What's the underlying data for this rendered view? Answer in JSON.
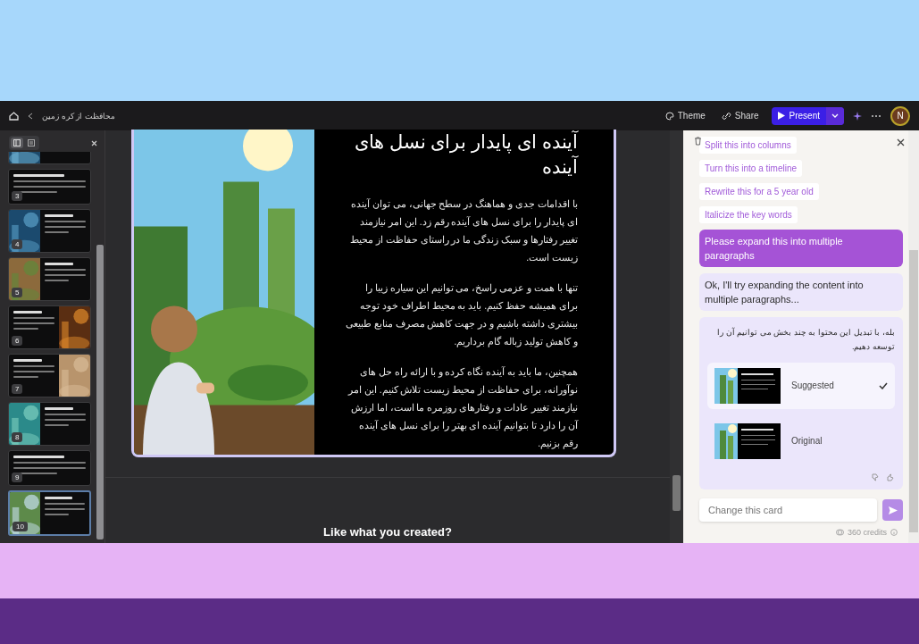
{
  "toolbar": {
    "breadcrumb": "محافظت از کره زمین",
    "theme_button": {
      "label": "Theme"
    },
    "share_button": {
      "label": "Share"
    },
    "present": {
      "label": "Present"
    },
    "avatar": "N"
  },
  "sidebar": {
    "view_tabs": [
      {
        "kind": "cards",
        "selected": true
      },
      {
        "kind": "outline",
        "selected": false
      }
    ],
    "slides": [
      {
        "kind": "image-left",
        "selected": false
      },
      {
        "number": "3",
        "kind": "text",
        "selected": false
      },
      {
        "number": "4",
        "kind": "image-left",
        "selected": false
      },
      {
        "number": "5",
        "kind": "image-left",
        "selected": false
      },
      {
        "number": "6",
        "kind": "image-right",
        "selected": false
      },
      {
        "number": "7",
        "kind": "image-right",
        "selected": false
      },
      {
        "number": "8",
        "kind": "image-left",
        "selected": false
      },
      {
        "number": "9",
        "kind": "text",
        "selected": false
      },
      {
        "number": "10",
        "kind": "image-left",
        "selected": true
      }
    ]
  },
  "slide": {
    "title": "آینده ای پایدار برای نسل های آینده",
    "paragraphs": [
      "با اقدامات جدی و هماهنگ در سطح جهانی، می توان آینده ای پایدار را برای نسل های آینده رقم زد. این امر نیازمند تغییر رفتارها و سبک زندگی ما در راستای حفاظت از محیط زیست است.",
      "تنها با همت و عزمی راسخ، می توانیم این سیاره زیبا را برای همیشه حفظ کنیم. باید به محیط اطراف خود توجه بیشتری داشته باشیم و در جهت کاهش مصرف منابع طبیعی و کاهش تولید زباله گام برداریم.",
      "همچنین، ما باید به آینده نگاه کرده و با ارائه راه حل های نوآورانه، برای حفاظت از محیط زیست تلاش کنیم. این امر نیازمند تغییر عادات و رفتارهای روزمره ما است، اما ارزش آن را دارد تا بتوانیم آینده ای بهتر را برای نسل های آینده رقم بزنیم."
    ]
  },
  "feedback_prompt": "Like what you created?",
  "assistant": {
    "suggestions": [
      "Split this into columns",
      "Turn this into a timeline",
      "Rewrite this for a 5 year old",
      "Italicize the key words"
    ],
    "messages": [
      {
        "kind": "user",
        "text": "Please expand this into multiple paragraphs"
      },
      {
        "kind": "assistant",
        "text": "Ok, I'll try expanding the content into multiple paragraphs..."
      },
      {
        "kind": "assistant",
        "text": "بله، با تبدیل این محتوا به چند بخش می توانیم آن را توسعه دهیم.",
        "options": [
          {
            "label": "Suggested",
            "selected": true
          },
          {
            "label": "Original",
            "selected": false
          }
        ]
      }
    ],
    "input": {
      "placeholder": "Change this card"
    },
    "credits": "360 credits"
  }
}
